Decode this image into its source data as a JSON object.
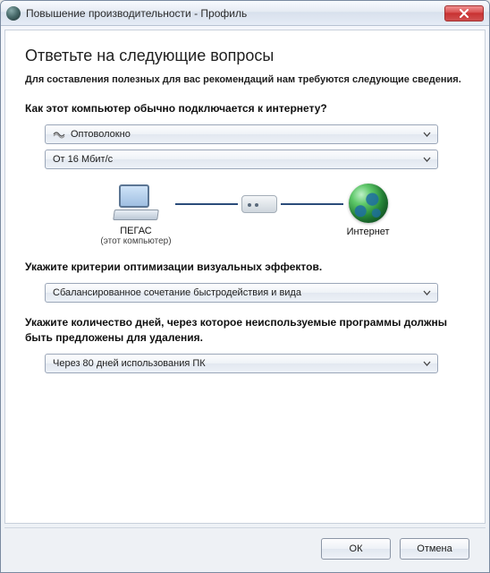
{
  "window": {
    "title": "Повышение производительности - Профиль"
  },
  "page": {
    "heading": "Ответьте на следующие вопросы",
    "subtitle": "Для составления полезных для вас рекомендаций нам требуются следующие сведения."
  },
  "q1": {
    "text": "Как этот компьютер обычно подключается к интернету?",
    "connection_type": "Оптоволокно",
    "speed": "От 16 Мбит/с"
  },
  "diagram": {
    "pc_label": "ПЕГАС",
    "pc_sublabel": "(этот компьютер)",
    "internet_label": "Интернет"
  },
  "q2": {
    "text": "Укажите критерии оптимизации визуальных эффектов.",
    "value": "Сбалансированное сочетание быстродействия и вида"
  },
  "q3": {
    "text": "Укажите количество дней, через которое неиспользуемые программы должны быть предложены для удаления.",
    "value": "Через 80 дней использования ПК"
  },
  "buttons": {
    "ok": "ОК",
    "cancel": "Отмена"
  }
}
